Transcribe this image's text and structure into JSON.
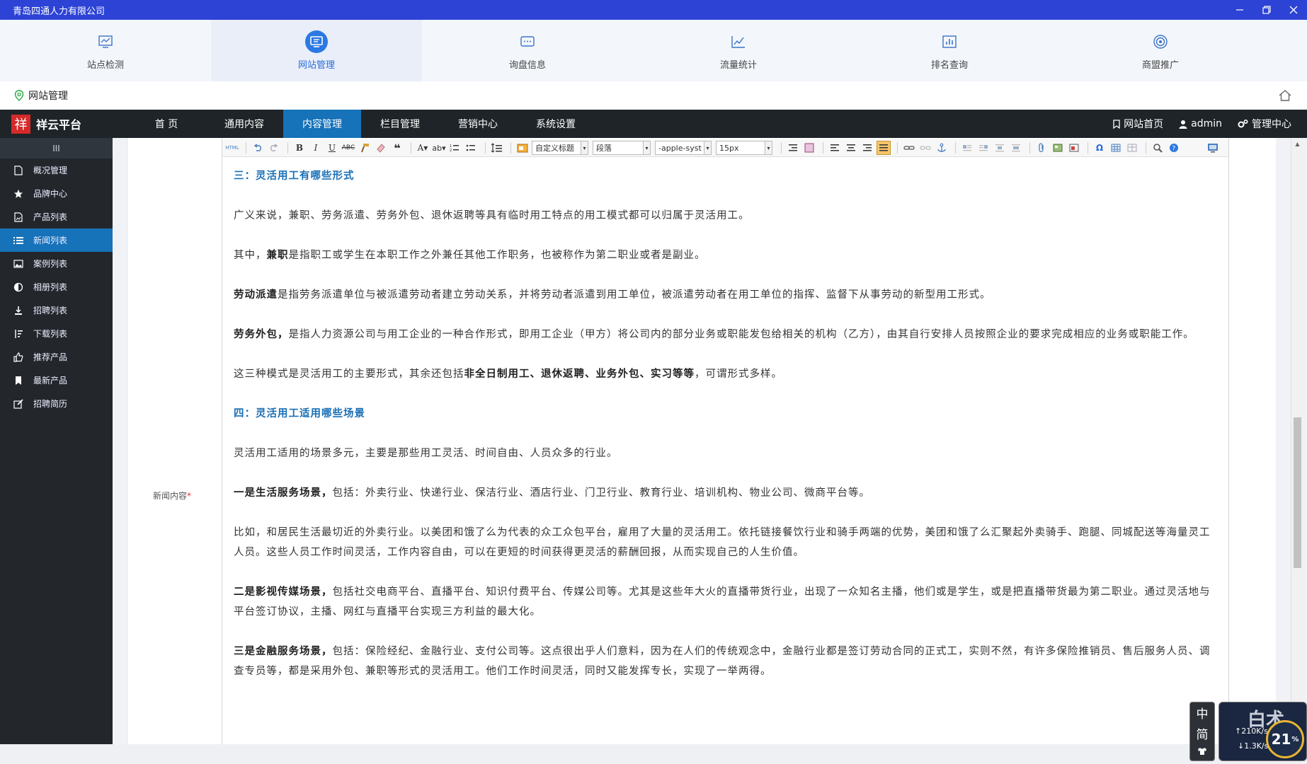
{
  "window": {
    "title": "青岛四通人力有限公司"
  },
  "topnav": [
    {
      "label": "站点检测",
      "icon": "monitor-chart-icon"
    },
    {
      "label": "网站管理",
      "icon": "monitor-icon",
      "active": true
    },
    {
      "label": "询盘信息",
      "icon": "chat-icon"
    },
    {
      "label": "流量统计",
      "icon": "line-chart-icon"
    },
    {
      "label": "排名查询",
      "icon": "bar-chart-icon"
    },
    {
      "label": "商盟推广",
      "icon": "target-icon"
    }
  ],
  "breadcrumb": {
    "text": "网站管理"
  },
  "brand": {
    "logo": "祥",
    "name": "祥云平台"
  },
  "mainmenu": [
    {
      "label": "首 页"
    },
    {
      "label": "通用内容"
    },
    {
      "label": "内容管理",
      "active": true
    },
    {
      "label": "栏目管理"
    },
    {
      "label": "营销中心"
    },
    {
      "label": "系统设置"
    }
  ],
  "navright": {
    "site_home": "网站首页",
    "user": "admin",
    "admin_center": "管理中心"
  },
  "sidebar": [
    {
      "label": "概况管理",
      "icon": "document-icon"
    },
    {
      "label": "品牌中心",
      "icon": "star-icon"
    },
    {
      "label": "产品列表",
      "icon": "image-file-icon"
    },
    {
      "label": "新闻列表",
      "icon": "list-icon",
      "active": true
    },
    {
      "label": "案例列表",
      "icon": "picture-icon"
    },
    {
      "label": "相册列表",
      "icon": "half-circle-icon"
    },
    {
      "label": "招聘列表",
      "icon": "download-icon"
    },
    {
      "label": "下载列表",
      "icon": "sort-icon"
    },
    {
      "label": "推荐产品",
      "icon": "thumbs-up-icon"
    },
    {
      "label": "最新产品",
      "icon": "bookmark-icon"
    },
    {
      "label": "招聘简历",
      "icon": "edit-icon"
    }
  ],
  "form": {
    "field_label": "新闻内容",
    "required_mark": "*"
  },
  "toolbar": {
    "html_label": "HTML",
    "heading_select": "自定义标题",
    "paragraph_select": "段落",
    "font_select": "-apple-syst",
    "size_select": "15px"
  },
  "content": {
    "h3": "三：灵活用工有哪些形式",
    "p1": "广义来说，兼职、劳务派遣、劳务外包、退休返聘等具有临时用工特点的用工模式都可以归属于灵活用工。",
    "p2_pre": "其中，",
    "p2_bold": "兼职",
    "p2_post": "是指职工或学生在本职工作之外兼任其他工作职务，也被称作为第二职业或者是副业。",
    "p3_bold": "劳动派遣",
    "p3_post": "是指劳务派遣单位与被派遣劳动者建立劳动关系，并将劳动者派遣到用工单位，被派遣劳动者在用工单位的指挥、监督下从事劳动的新型用工形式。",
    "p4_bold": "劳务外包，",
    "p4_post": "是指人力资源公司与用工企业的一种合作形式，即用工企业（甲方）将公司内的部分业务或职能发包给相关的机构（乙方），由其自行安排人员按照企业的要求完成相应的业务或职能工作。",
    "p5_pre": "这三种模式是灵活用工的主要形式，其余还包括",
    "p5_bold": "非全日制用工、退休返聘、业务外包、实习等等",
    "p5_post": "，可谓形式多样。",
    "h4": "四：灵活用工适用哪些场景",
    "p6": "灵活用工适用的场景多元，主要是那些用工灵活、时间自由、人员众多的行业。",
    "p7_bold": "一是生活服务场景，",
    "p7_post": "包括：外卖行业、快递行业、保洁行业、酒店行业、门卫行业、教育行业、培训机构、物业公司、微商平台等。",
    "p8": "比如，和居民生活最切近的外卖行业。以美团和饿了么为代表的众工众包平台，雇用了大量的灵活用工。依托链接餐饮行业和骑手两端的优势，美团和饿了么汇聚起外卖骑手、跑腿、同城配送等海量灵工人员。这些人员工作时间灵活，工作内容自由，可以在更短的时间获得更灵活的薪酬回报，从而实现自己的人生价值。",
    "p9_bold": "二是影视传媒场景，",
    "p9_post": "包括社交电商平台、直播平台、知识付费平台、传媒公司等。尤其是这些年大火的直播带货行业，出现了一众知名主播，他们或是学生，或是把直播带货最为第二职业。通过灵活地与平台签订协议，主播、网红与直播平台实现三方利益的最大化。",
    "p10_bold": "三是金融服务场景，",
    "p10_post": "包括：保险经纪、金融行业、支付公司等。这点很出乎人们意料，因为在人们的传统观念中，金融行业都是签订劳动合同的正式工，实则不然，有许多保险推销员、售后服务人员、调查专员等，都是采用外包、兼职等形式的灵活用工。他们工作时间灵活，同时又能发挥专长，实现了一举两得。"
  },
  "ime": {
    "c1": "中",
    "c2": "简"
  },
  "netwidget": {
    "upload": "210K/s",
    "download": "1.3K/s",
    "percent": "21",
    "percent_sign": "%"
  }
}
